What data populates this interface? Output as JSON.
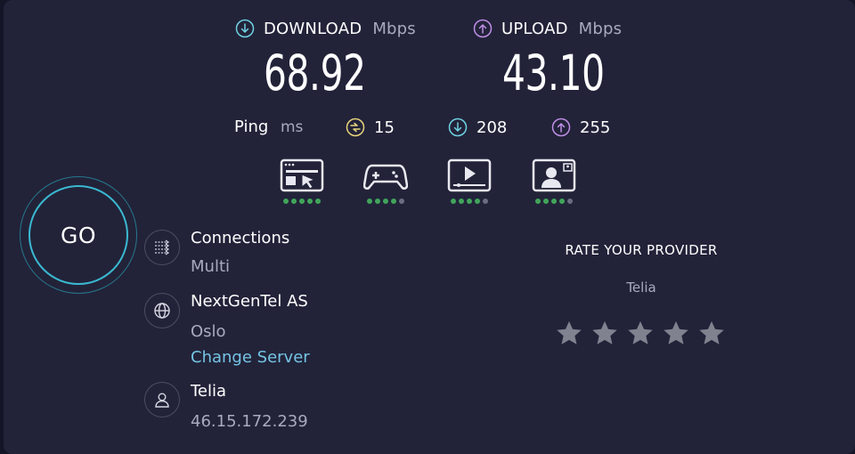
{
  "download": {
    "label": "DOWNLOAD",
    "unit": "Mbps",
    "value": "68.92"
  },
  "upload": {
    "label": "UPLOAD",
    "unit": "Mbps",
    "value": "43.10"
  },
  "ping": {
    "label": "Ping",
    "unit": "ms",
    "jitter": "15",
    "download": "208",
    "upload": "255"
  },
  "usage": [
    {
      "name": "web-browsing",
      "level": 5,
      "max": 5
    },
    {
      "name": "gaming",
      "level": 4,
      "max": 5
    },
    {
      "name": "streaming",
      "level": 4,
      "max": 5
    },
    {
      "name": "video-calls",
      "level": 4,
      "max": 5
    }
  ],
  "go_label": "GO",
  "connections": {
    "title": "Connections",
    "value": "Multi"
  },
  "server": {
    "name": "NextGenTel AS",
    "city": "Oslo",
    "change_label": "Change Server"
  },
  "isp": {
    "name": "Telia",
    "ip": "46.15.172.239"
  },
  "rate": {
    "title": "RATE YOUR PROVIDER",
    "provider": "Telia",
    "stars": 5
  },
  "colors": {
    "download": "#6fd2e2",
    "upload": "#c08ee6",
    "jitter": "#e8d47a",
    "good": "#41a55a",
    "go_ring": "#3ab9d1"
  }
}
